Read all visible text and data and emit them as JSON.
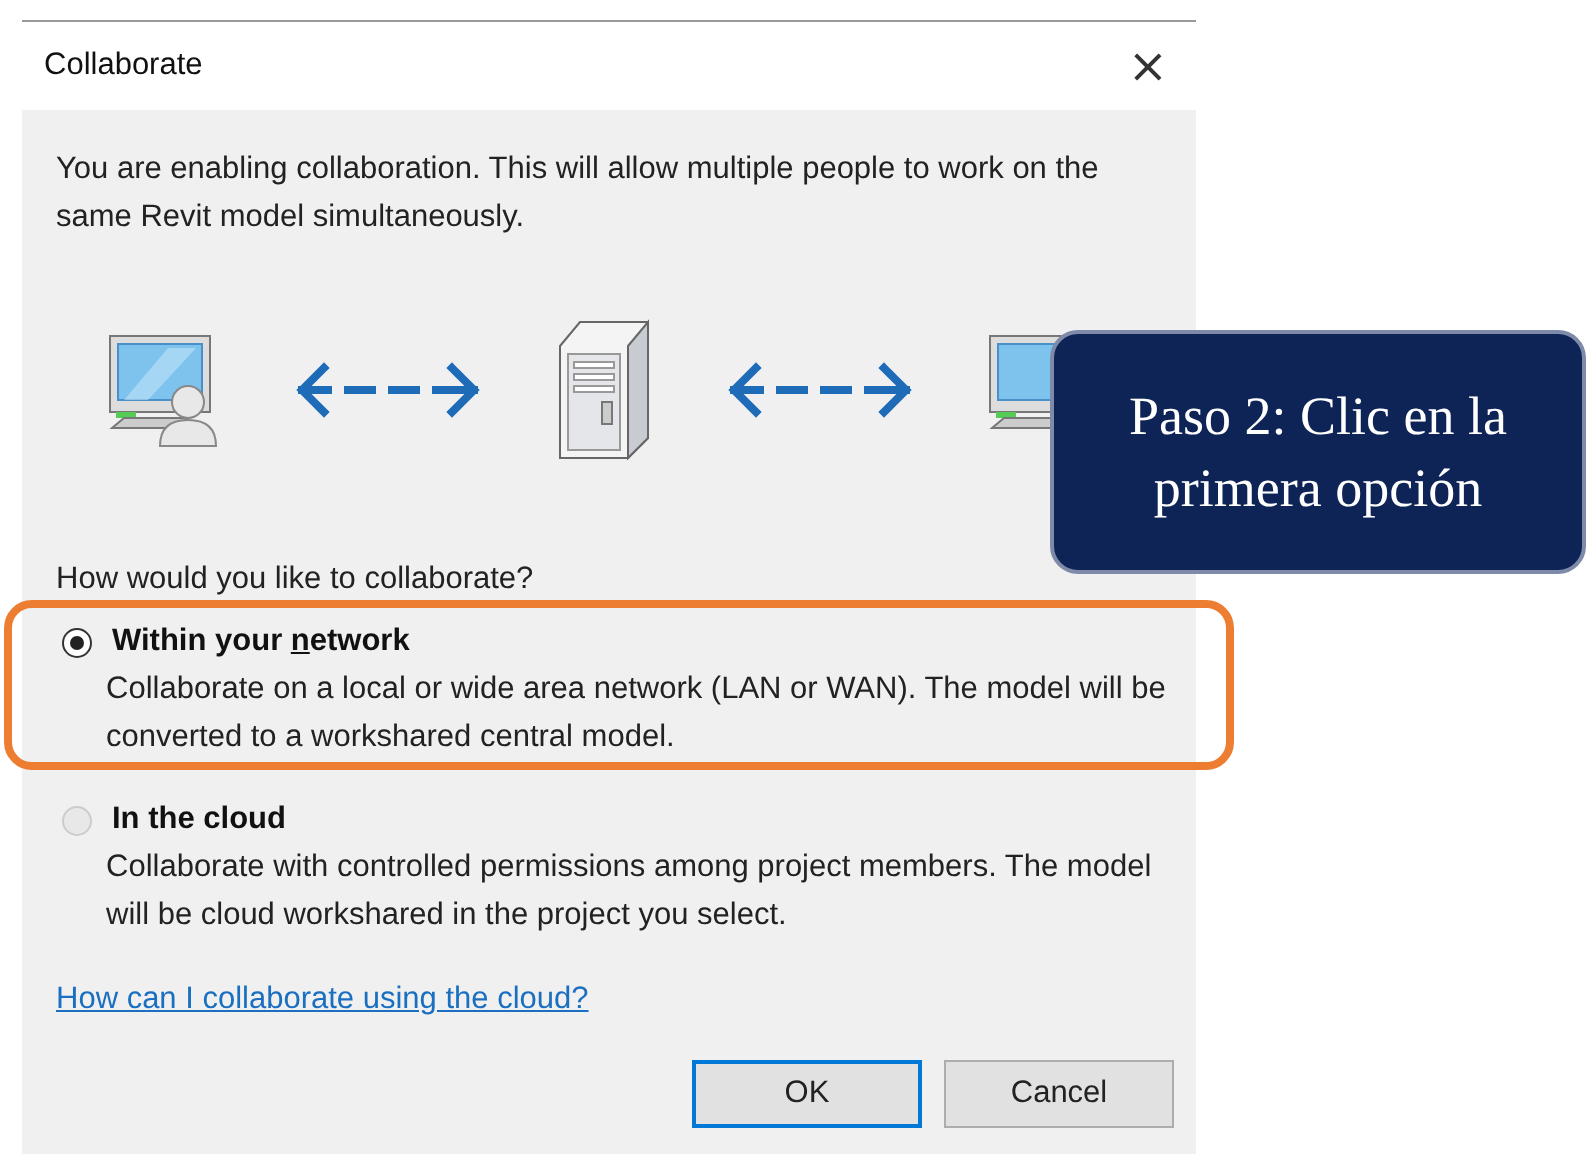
{
  "window": {
    "title": "Collaborate",
    "close": "×"
  },
  "intro": "You are enabling collaboration. This will allow multiple people to work on the same Revit model simultaneously.",
  "question": "How would you like to collaborate?",
  "options": [
    {
      "label_parts": [
        "Within your ",
        "n",
        "etwork"
      ],
      "description": "Collaborate on a local or wide area network (LAN or WAN). The model will be converted to a workshared central model.",
      "selected": true,
      "highlighted": true
    },
    {
      "label_parts": [
        "In the cloud"
      ],
      "description": "Collaborate with controlled permissions among project members. The model will be cloud workshared in the project you select.",
      "selected": false,
      "highlighted": false
    }
  ],
  "help_link": "How can I collaborate using the cloud?",
  "buttons": [
    {
      "label": "OK",
      "default": true
    },
    {
      "label": "Cancel",
      "default": false
    }
  ],
  "callout": "Paso 2: Clic en la primera opción"
}
